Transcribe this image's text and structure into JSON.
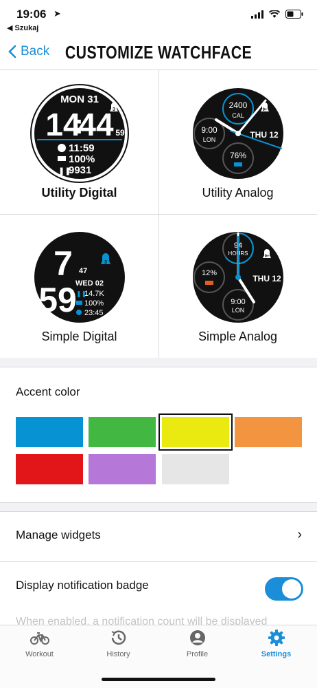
{
  "status": {
    "time": "19:06",
    "back_app": "◀ Szukaj"
  },
  "nav": {
    "back_label": "Back",
    "title": "CUSTOMIZE WATCHFACE"
  },
  "watchfaces": [
    {
      "label": "Utility Digital",
      "selected": true,
      "date": "MON 31",
      "hours": "14",
      "minutes": "44",
      "seconds": "59",
      "badge": "3",
      "world_time": "11:59",
      "battery": "100%",
      "steps": "9931"
    },
    {
      "label": "Utility Analog",
      "calories": "2400",
      "calories_unit": "CAL",
      "world_time": "9:00",
      "world_city": "LON",
      "date": "THU 12",
      "battery": "76%",
      "badge": "9+"
    },
    {
      "label": "Simple Digital",
      "hours": "7",
      "minutes": "59",
      "seconds": "47",
      "date": "WED 02",
      "steps": "14.7K",
      "battery": "100%",
      "world_time": "23:45",
      "badge": "3"
    },
    {
      "label": "Simple Analog",
      "hours_count": "94",
      "hours_unit": "HOURS",
      "battery": "12%",
      "world_time": "9:00",
      "world_city": "LON",
      "date": "THU 12",
      "badge": "9+"
    }
  ],
  "accent": {
    "title": "Accent color",
    "selected_index": 2,
    "colors": [
      "#0793d3",
      "#42b843",
      "#eaea10",
      "#f39440",
      "#e21618",
      "#b578d8",
      "#e6e6e6"
    ]
  },
  "rows": {
    "manage_widgets": "Manage widgets",
    "notification_badge": "Display notification badge",
    "notification_badge_on": true,
    "notification_desc": "When enabled, a notification count will be displayed"
  },
  "tabs": [
    {
      "label": "Workout",
      "icon": "bicycle-icon"
    },
    {
      "label": "History",
      "icon": "history-icon"
    },
    {
      "label": "Profile",
      "icon": "profile-icon"
    },
    {
      "label": "Settings",
      "icon": "gear-icon",
      "active": true
    }
  ]
}
